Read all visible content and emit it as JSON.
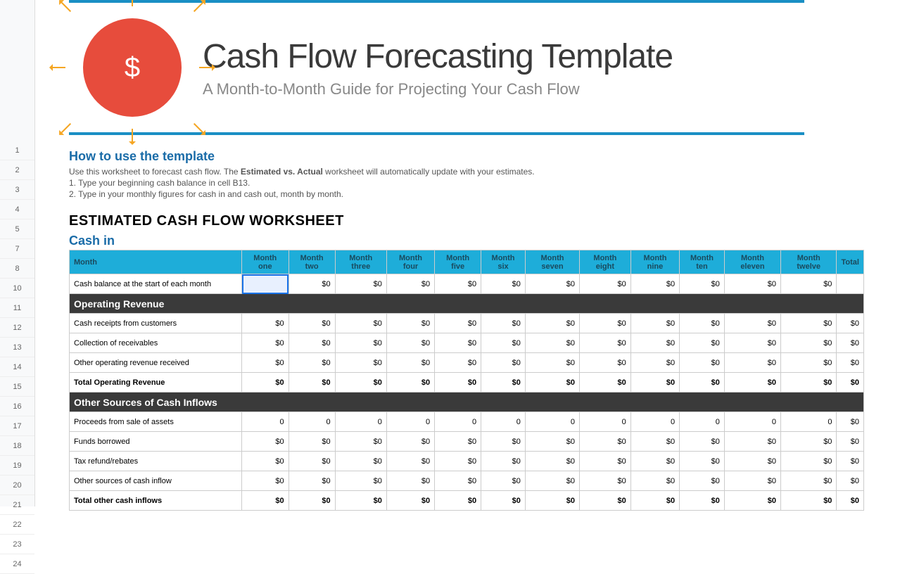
{
  "banner": {
    "title": "Cash Flow Forecasting Template",
    "subtitle": "A Month-to-Month Guide for Projecting Your Cash Flow",
    "logo_symbol": "$"
  },
  "howto": {
    "title": "How to use the template",
    "desc_before": "Use this worksheet to forecast cash flow. The ",
    "desc_bold": "Estimated vs. Actual",
    "desc_after": " worksheet will automatically update with your estimates.",
    "step1": "1. Type your beginning cash balance in cell B13.",
    "step2": "2. Type in your monthly figures for cash in and cash out, month by month."
  },
  "worksheet_title": "ESTIMATED CASH FLOW WORKSHEET",
  "cashin_title": "Cash in",
  "row_numbers": [
    "1",
    "2",
    "3",
    "4",
    "5",
    "7",
    "8",
    "10",
    "11",
    "12",
    "13",
    "14",
    "15",
    "16",
    "17",
    "18",
    "19",
    "20",
    "21",
    "22",
    "23",
    "24"
  ],
  "headers": [
    "Month",
    "Month one",
    "Month two",
    "Month three",
    "Month four",
    "Month five",
    "Month six",
    "Month seven",
    "Month eight",
    "Month nine",
    "Month ten",
    "Month eleven",
    "Month twelve",
    "Total"
  ],
  "rows": {
    "cash_balance": {
      "label": "Cash balance at the start of each month",
      "values": [
        "",
        "$0",
        "$0",
        "$0",
        "$0",
        "$0",
        "$0",
        "$0",
        "$0",
        "$0",
        "$0",
        "$0",
        ""
      ]
    },
    "section1": "Operating Revenue",
    "cash_receipts": {
      "label": "Cash receipts from customers",
      "values": [
        "$0",
        "$0",
        "$0",
        "$0",
        "$0",
        "$0",
        "$0",
        "$0",
        "$0",
        "$0",
        "$0",
        "$0",
        "$0"
      ]
    },
    "collection": {
      "label": "Collection of receivables",
      "values": [
        "$0",
        "$0",
        "$0",
        "$0",
        "$0",
        "$0",
        "$0",
        "$0",
        "$0",
        "$0",
        "$0",
        "$0",
        "$0"
      ]
    },
    "other_rev": {
      "label": "Other operating revenue received",
      "values": [
        "$0",
        "$0",
        "$0",
        "$0",
        "$0",
        "$0",
        "$0",
        "$0",
        "$0",
        "$0",
        "$0",
        "$0",
        "$0"
      ]
    },
    "total_rev": {
      "label": "Total Operating Revenue",
      "values": [
        "$0",
        "$0",
        "$0",
        "$0",
        "$0",
        "$0",
        "$0",
        "$0",
        "$0",
        "$0",
        "$0",
        "$0",
        "$0"
      ]
    },
    "section2": "Other Sources of Cash Inflows",
    "proceeds": {
      "label": "Proceeds from sale of assets",
      "values": [
        "0",
        "0",
        "0",
        "0",
        "0",
        "0",
        "0",
        "0",
        "0",
        "0",
        "0",
        "0",
        "$0"
      ]
    },
    "funds": {
      "label": "Funds borrowed",
      "values": [
        "$0",
        "$0",
        "$0",
        "$0",
        "$0",
        "$0",
        "$0",
        "$0",
        "$0",
        "$0",
        "$0",
        "$0",
        "$0"
      ]
    },
    "tax": {
      "label": "Tax refund/rebates",
      "values": [
        "$0",
        "$0",
        "$0",
        "$0",
        "$0",
        "$0",
        "$0",
        "$0",
        "$0",
        "$0",
        "$0",
        "$0",
        "$0"
      ]
    },
    "other_src": {
      "label": "Other sources of cash inflow",
      "values": [
        "$0",
        "$0",
        "$0",
        "$0",
        "$0",
        "$0",
        "$0",
        "$0",
        "$0",
        "$0",
        "$0",
        "$0",
        "$0"
      ]
    },
    "total_other": {
      "label": "Total other cash inflows",
      "values": [
        "$0",
        "$0",
        "$0",
        "$0",
        "$0",
        "$0",
        "$0",
        "$0",
        "$0",
        "$0",
        "$0",
        "$0",
        "$0"
      ]
    }
  }
}
